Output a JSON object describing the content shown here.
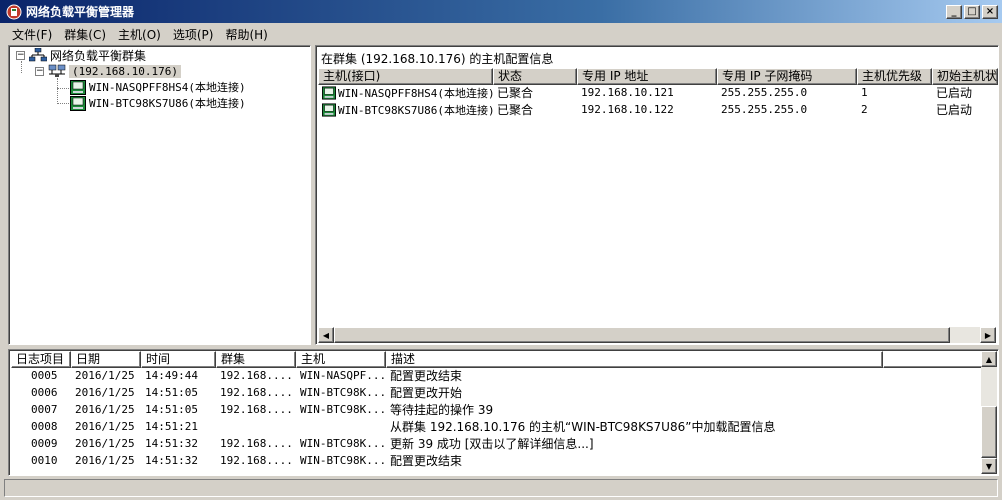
{
  "window": {
    "title": "网络负载平衡管理器",
    "controls": {
      "minimize": "_",
      "maximize": "□",
      "close": "×"
    }
  },
  "menu": [
    "文件(F)",
    "群集(C)",
    "主机(O)",
    "选项(P)",
    "帮助(H)"
  ],
  "tree": {
    "root": {
      "label": "网络负载平衡群集",
      "expander": "−"
    },
    "cluster": {
      "label": "(192.168.10.176)",
      "expander": "−"
    },
    "hosts": [
      {
        "label": "WIN-NASQPFF8HS4(本地连接)"
      },
      {
        "label": "WIN-BTC98KS7U86(本地连接)"
      }
    ]
  },
  "host_list": {
    "caption": "在群集 (192.168.10.176) 的主机配置信息",
    "columns": [
      "主机(接口)",
      "状态",
      "专用 IP 地址",
      "专用 IP 子网掩码",
      "主机优先级",
      "初始主机状"
    ],
    "rows": [
      {
        "host": "WIN-NASQPFF8HS4(本地连接)",
        "status": "已聚合",
        "ip": "192.168.10.121",
        "mask": "255.255.255.0",
        "priority": "1",
        "initial_state": "已启动"
      },
      {
        "host": "WIN-BTC98KS7U86(本地连接)",
        "status": "已聚合",
        "ip": "192.168.10.122",
        "mask": "255.255.255.0",
        "priority": "2",
        "initial_state": "已启动"
      }
    ]
  },
  "log": {
    "columns": [
      "日志项目",
      "日期",
      "时间",
      "群集",
      "主机",
      "描述"
    ],
    "rows": [
      {
        "id": "0005",
        "date": "2016/1/25",
        "time": "14:49:44",
        "cluster": "192.168....",
        "host": "WIN-NASQPF...",
        "desc": "配置更改结束"
      },
      {
        "id": "0006",
        "date": "2016/1/25",
        "time": "14:51:05",
        "cluster": "192.168....",
        "host": "WIN-BTC98K...",
        "desc": "配置更改开始"
      },
      {
        "id": "0007",
        "date": "2016/1/25",
        "time": "14:51:05",
        "cluster": "192.168....",
        "host": "WIN-BTC98K...",
        "desc": "等待挂起的操作 39"
      },
      {
        "id": "0008",
        "date": "2016/1/25",
        "time": "14:51:21",
        "cluster": "",
        "host": "",
        "desc": "从群集 192.168.10.176 的主机“WIN-BTC98KS7U86”中加载配置信息"
      },
      {
        "id": "0009",
        "date": "2016/1/25",
        "time": "14:51:32",
        "cluster": "192.168....",
        "host": "WIN-BTC98K...",
        "desc": "更新 39 成功 [双击以了解详细信息...]"
      },
      {
        "id": "0010",
        "date": "2016/1/25",
        "time": "14:51:32",
        "cluster": "192.168....",
        "host": "WIN-BTC98K...",
        "desc": "配置更改结束"
      }
    ]
  },
  "scroll_arrows": {
    "left": "◀",
    "right": "▶",
    "up": "▲",
    "down": "▼"
  }
}
